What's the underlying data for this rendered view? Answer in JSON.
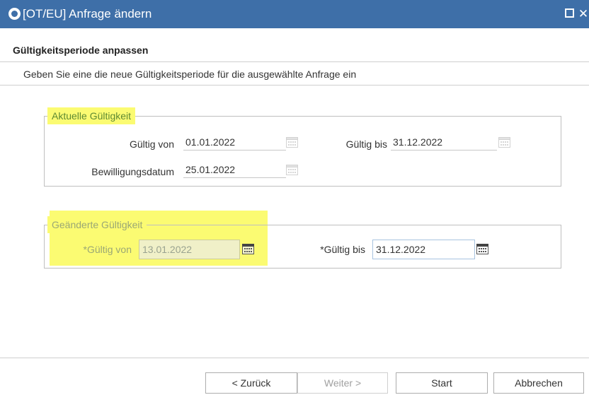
{
  "window": {
    "title": "[OT/EU] Anfrage ändern",
    "maximize_icon": "maximize-icon",
    "close_label": "✕"
  },
  "header": {
    "title": "Gültigkeitsperiode anpassen",
    "description": "Geben Sie eine die neue Gültigkeitsperiode für die ausgewählte Anfrage ein"
  },
  "current_validity": {
    "legend": "Aktuelle Gültigkeit",
    "valid_from_label": "Gültig von",
    "valid_from_value": "01.01.2022",
    "valid_to_label": "Gültig bis",
    "valid_to_value": "31.12.2022",
    "approval_date_label": "Bewilligungsdatum",
    "approval_date_value": "25.01.2022"
  },
  "changed_validity": {
    "legend": "Geänderte Gültigkeit",
    "valid_from_label": "*Gültig von",
    "valid_from_value": "13.01.2022",
    "valid_to_label": "*Gültig bis",
    "valid_to_value": "31.12.2022"
  },
  "buttons": {
    "back": "< Zurück",
    "next": "Weiter >",
    "start": "Start",
    "cancel": "Abbrechen"
  },
  "colors": {
    "titlebar": "#3e6fa8",
    "highlight": "#fbfb72",
    "legend_text": "#5e8a32"
  }
}
